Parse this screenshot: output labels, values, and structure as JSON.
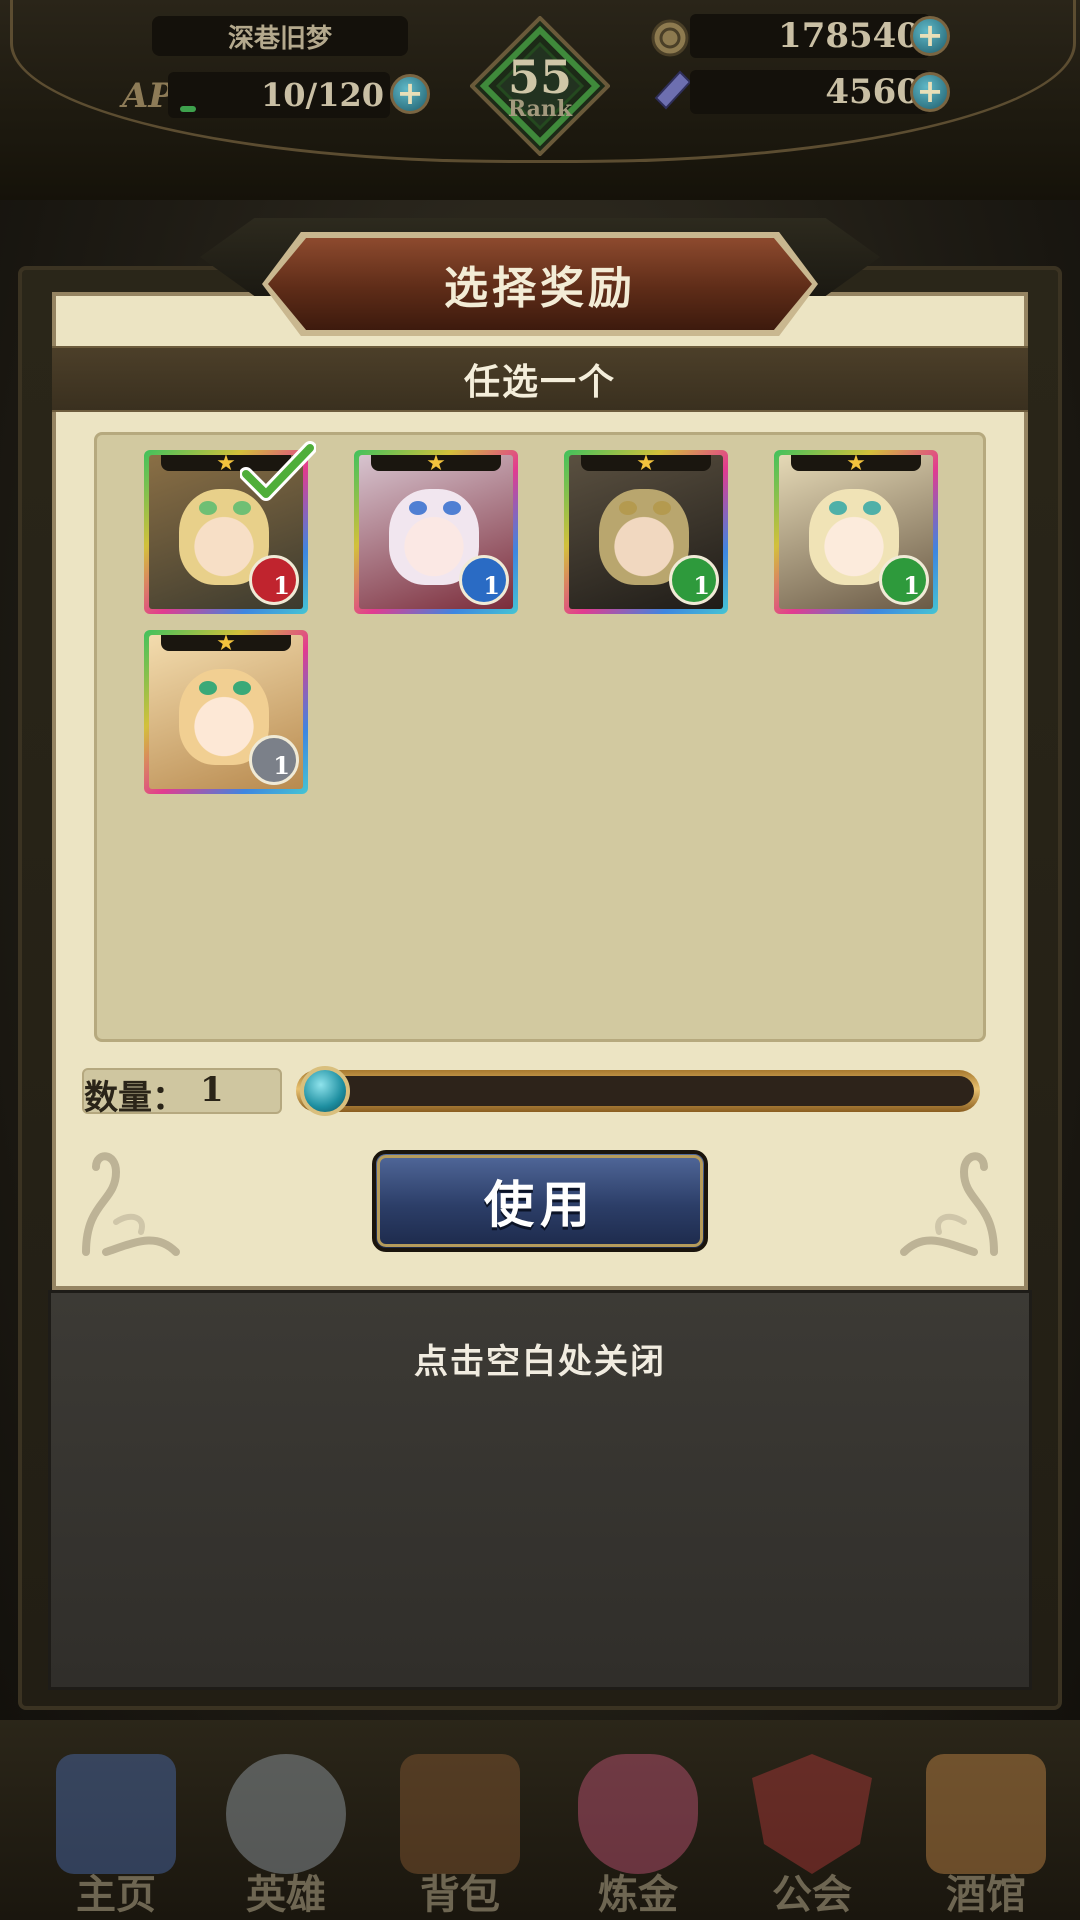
{
  "hud": {
    "player_name": "深巷旧梦",
    "ap_label": "AP",
    "ap_value": "10/120",
    "ap_fraction": 0.083,
    "rank_number": "55",
    "rank_label": "Rank",
    "gold": "178540",
    "gems": "4560",
    "plus_symbol": "+"
  },
  "dialog": {
    "title": "选择奖励",
    "subtitle": "任选一个",
    "rewards": [
      {
        "star": "★",
        "badge": "1",
        "badge_color": "#c0242e",
        "hair": "#e8d08a",
        "eyes": "#6fbf74",
        "selected": true
      },
      {
        "star": "★",
        "badge": "1",
        "badge_color": "#2a6bc4",
        "hair": "#f1e6ef",
        "eyes": "#4f7fd3",
        "selected": false
      },
      {
        "star": "★",
        "badge": "1",
        "badge_color": "#2e9a3c",
        "hair": "#b9a66e",
        "eyes": "#b49a4f",
        "selected": false
      },
      {
        "star": "★",
        "badge": "1",
        "badge_color": "#2e9a3c",
        "hair": "#f0e3b6",
        "eyes": "#4fb0a8",
        "selected": false
      },
      {
        "star": "★",
        "badge": "1",
        "badge_color": "#7b8089",
        "hair": "#f1cf92",
        "eyes": "#3aa978",
        "selected": false
      }
    ],
    "quantity_label": "数量：",
    "quantity_value": "1",
    "slider_fraction": 0.0,
    "use_button": "使用",
    "close_hint": "点击空白处关闭"
  },
  "nav": {
    "items": [
      {
        "label": "主页",
        "color": "#4b6fb3"
      },
      {
        "label": "英雄",
        "color": "#9aa3ad"
      },
      {
        "label": "背包",
        "color": "#8a5a33"
      },
      {
        "label": "炼金",
        "color": "#c7567a"
      },
      {
        "label": "公会",
        "color": "#b33a3a"
      },
      {
        "label": "酒馆",
        "color": "#c98b4a"
      }
    ]
  },
  "colors": {
    "accent_gold": "#d9bf7d",
    "panel_bg": "#ece4c3",
    "button_blue": "#2c3e68"
  }
}
